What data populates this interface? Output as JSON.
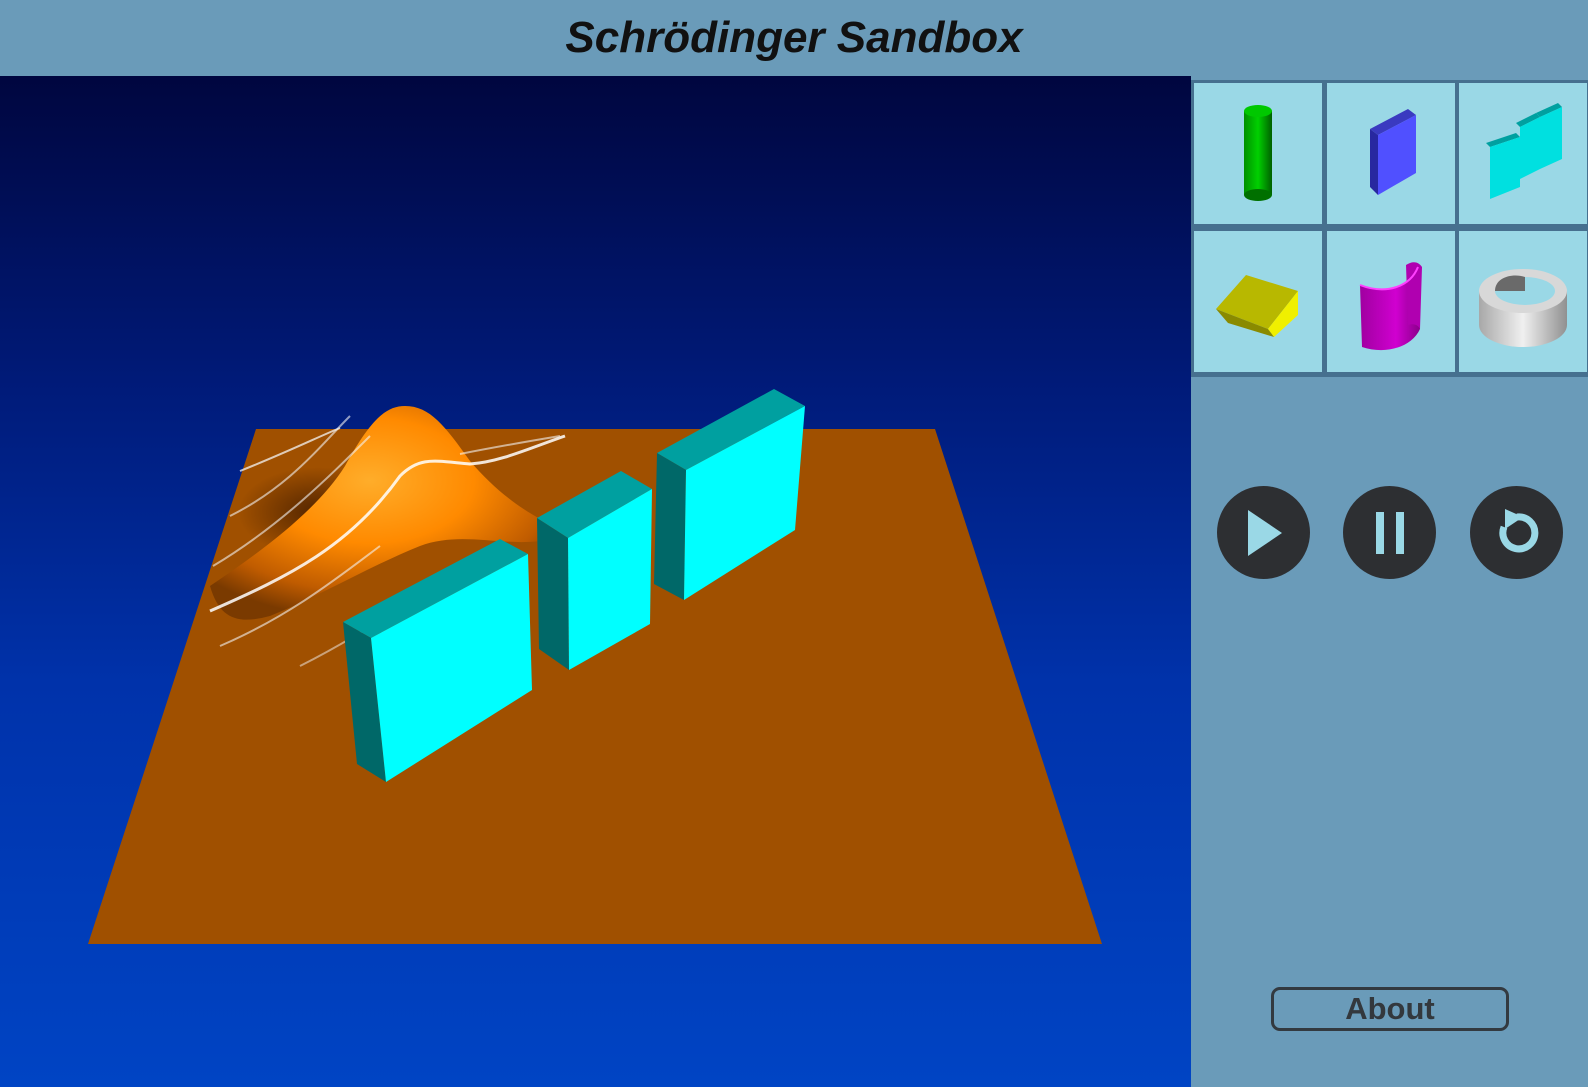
{
  "app": {
    "title": "Schrödinger Sandbox"
  },
  "scene": {
    "floor_color": "#a05000",
    "wave_color": "#ff8a00",
    "barrier_color": "#00ffff",
    "background_gradient": [
      "#00063f",
      "#0044c4"
    ]
  },
  "palette": {
    "items": [
      {
        "icon": "cylinder-icon",
        "color": "#00c000"
      },
      {
        "icon": "box-icon",
        "color": "#5050ff"
      },
      {
        "icon": "triple-slit-icon",
        "color": "#00e0e0"
      },
      {
        "icon": "wedge-icon",
        "color": "#c8c000"
      },
      {
        "icon": "half-pipe-icon",
        "color": "#d000d0"
      },
      {
        "icon": "ring-icon",
        "color": "#c0c0c0"
      }
    ]
  },
  "controls": {
    "play_icon": "play-icon",
    "pause_icon": "pause-icon",
    "reset_icon": "reset-icon",
    "icon_color": "#9ad8e6"
  },
  "footer": {
    "about_label": "About"
  }
}
